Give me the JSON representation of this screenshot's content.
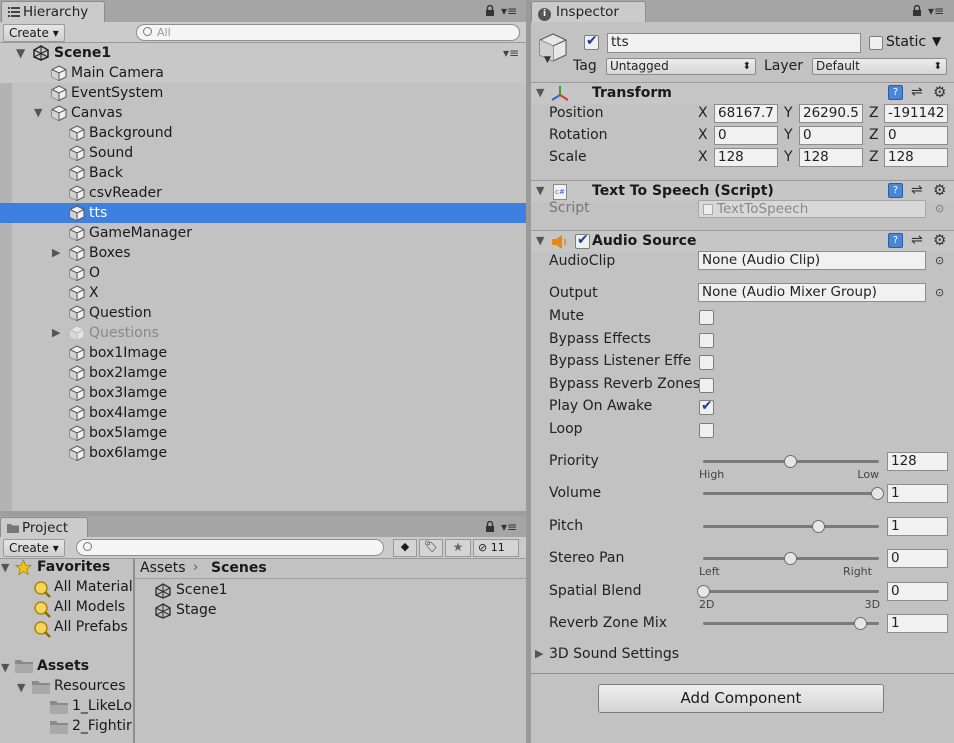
{
  "hierarchy": {
    "tab": "Hierarchy",
    "create": "Create",
    "search_placeholder": "All",
    "scene": "Scene1",
    "items": [
      {
        "label": "Main Camera",
        "indent": 1,
        "arrow": "",
        "selected": false,
        "dim": false
      },
      {
        "label": "EventSystem",
        "indent": 1,
        "arrow": "",
        "selected": false,
        "dim": false
      },
      {
        "label": "Canvas",
        "indent": 1,
        "arrow": "down",
        "selected": false,
        "dim": false
      },
      {
        "label": "Background",
        "indent": 2,
        "arrow": "",
        "selected": false,
        "dim": false
      },
      {
        "label": "Sound",
        "indent": 2,
        "arrow": "",
        "selected": false,
        "dim": false
      },
      {
        "label": "Back",
        "indent": 2,
        "arrow": "",
        "selected": false,
        "dim": false
      },
      {
        "label": "csvReader",
        "indent": 2,
        "arrow": "",
        "selected": false,
        "dim": false
      },
      {
        "label": "tts",
        "indent": 2,
        "arrow": "",
        "selected": true,
        "dim": false
      },
      {
        "label": "GameManager",
        "indent": 2,
        "arrow": "",
        "selected": false,
        "dim": false
      },
      {
        "label": "Boxes",
        "indent": 2,
        "arrow": "right",
        "selected": false,
        "dim": false
      },
      {
        "label": "O",
        "indent": 2,
        "arrow": "",
        "selected": false,
        "dim": false
      },
      {
        "label": "X",
        "indent": 2,
        "arrow": "",
        "selected": false,
        "dim": false
      },
      {
        "label": "Question",
        "indent": 2,
        "arrow": "",
        "selected": false,
        "dim": false
      },
      {
        "label": "Questions",
        "indent": 2,
        "arrow": "right",
        "selected": false,
        "dim": true
      },
      {
        "label": "box1Image",
        "indent": 2,
        "arrow": "",
        "selected": false,
        "dim": false
      },
      {
        "label": "box2Iamge",
        "indent": 2,
        "arrow": "",
        "selected": false,
        "dim": false
      },
      {
        "label": "box3Iamge",
        "indent": 2,
        "arrow": "",
        "selected": false,
        "dim": false
      },
      {
        "label": "box4Iamge",
        "indent": 2,
        "arrow": "",
        "selected": false,
        "dim": false
      },
      {
        "label": "box5Iamge",
        "indent": 2,
        "arrow": "",
        "selected": false,
        "dim": false
      },
      {
        "label": "box6Iamge",
        "indent": 2,
        "arrow": "",
        "selected": false,
        "dim": false
      }
    ]
  },
  "project": {
    "tab": "Project",
    "create": "Create",
    "hidden_count": "11",
    "favorites": {
      "label": "Favorites",
      "items": [
        "All Materials",
        "All Models",
        "All Prefabs"
      ]
    },
    "assets": {
      "label": "Assets",
      "resources": "Resources",
      "children": [
        "1_LikeLo",
        "2_Fightir"
      ]
    },
    "breadcrumb": {
      "root": "Assets",
      "current": "Scenes"
    },
    "files": [
      "Scene1",
      "Stage"
    ]
  },
  "inspector": {
    "tab": "Inspector",
    "object_name": "tts",
    "static_label": "Static",
    "tag_label": "Tag",
    "tag_value": "Untagged",
    "layer_label": "Layer",
    "layer_value": "Default",
    "transform": {
      "title": "Transform",
      "rows": [
        {
          "label": "Position",
          "x": "68167.7",
          "y": "26290.5",
          "z": "-191142"
        },
        {
          "label": "Rotation",
          "x": "0",
          "y": "0",
          "z": "0"
        },
        {
          "label": "Scale",
          "x": "128",
          "y": "128",
          "z": "128"
        }
      ],
      "axis": {
        "x": "X",
        "y": "Y",
        "z": "Z"
      }
    },
    "tts_script": {
      "title": "Text To Speech (Script)",
      "script_label": "Script",
      "script_value": "TextToSpeech"
    },
    "audio": {
      "title": "Audio Source",
      "clip_label": "AudioClip",
      "clip_value": "None (Audio Clip)",
      "output_label": "Output",
      "output_value": "None (Audio Mixer Group)",
      "toggles": [
        {
          "label": "Mute",
          "checked": false
        },
        {
          "label": "Bypass Effects",
          "checked": false
        },
        {
          "label": "Bypass Listener Effe",
          "checked": false
        },
        {
          "label": "Bypass Reverb Zones",
          "checked": false
        },
        {
          "label": "Play On Awake",
          "checked": true
        },
        {
          "label": "Loop",
          "checked": false
        }
      ],
      "sliders": [
        {
          "label": "Priority",
          "value": "128",
          "fraction": 0.5,
          "min_label": "High",
          "max_label": "Low"
        },
        {
          "label": "Volume",
          "value": "1",
          "fraction": 1.0,
          "min_label": "",
          "max_label": ""
        },
        {
          "label": "Pitch",
          "value": "1",
          "fraction": 0.66,
          "min_label": "",
          "max_label": ""
        },
        {
          "label": "Stereo Pan",
          "value": "0",
          "fraction": 0.5,
          "min_label": "Left",
          "max_label": "Right"
        },
        {
          "label": "Spatial Blend",
          "value": "0",
          "fraction": 0.0,
          "min_label": "2D",
          "max_label": "3D"
        },
        {
          "label": "Reverb Zone Mix",
          "value": "1",
          "fraction": 0.9,
          "min_label": "",
          "max_label": ""
        }
      ],
      "sound3d": "3D Sound Settings"
    },
    "add_component": "Add Component"
  },
  "colors": {
    "selection": "#3d80df",
    "accent_check": "#1b3f99"
  }
}
